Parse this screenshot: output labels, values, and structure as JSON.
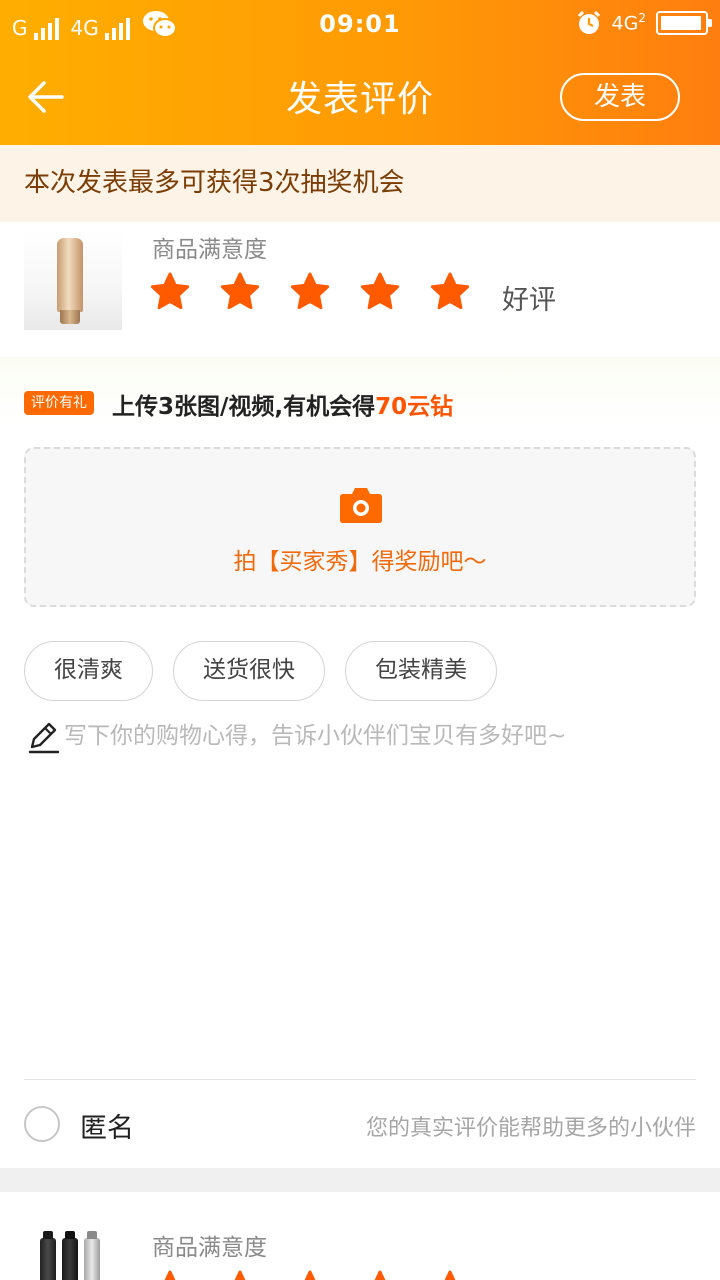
{
  "status_bar": {
    "carrier1": "G",
    "carrier2": "4G",
    "time": "09:01",
    "network": "4G",
    "network_sub": "2",
    "icons": [
      "signal-icon",
      "wechat-icon",
      "alarm-icon",
      "battery-icon"
    ]
  },
  "header": {
    "title": "发表评价",
    "publish_label": "发表",
    "back_icon": "back-arrow-icon"
  },
  "notice": {
    "text": "本次发表最多可获得3次抽奖机会"
  },
  "products": [
    {
      "satisfaction_label": "商品满意度",
      "rating": 5,
      "max_rating": 5,
      "rating_word": "好评"
    },
    {
      "satisfaction_label": "商品满意度",
      "rating": 5,
      "max_rating": 5
    }
  ],
  "promo": {
    "tag": "评价有礼",
    "text_prefix": "上传3张图/视频,有机会得",
    "text_highlight": "70云钻"
  },
  "upload": {
    "icon": "camera-icon",
    "text": "拍【买家秀】得奖励吧～"
  },
  "quick_tags": [
    "很清爽",
    "送货很快",
    "包装精美"
  ],
  "comment": {
    "placeholder": "写下你的购物心得，告诉小伙伴们宝贝有多好吧~",
    "value": ""
  },
  "anonymous": {
    "label": "匿名",
    "hint": "您的真实评价能帮助更多的小伙伴",
    "checked": false
  },
  "colors": {
    "header_start": "#ffae00",
    "header_end": "#ff7e0f",
    "star": "#ff5a00",
    "promo_highlight": "#ff5500",
    "notice_bg": "#fdf3e6",
    "notice_text": "#7a3d05",
    "upload_text": "#f06a0c"
  }
}
